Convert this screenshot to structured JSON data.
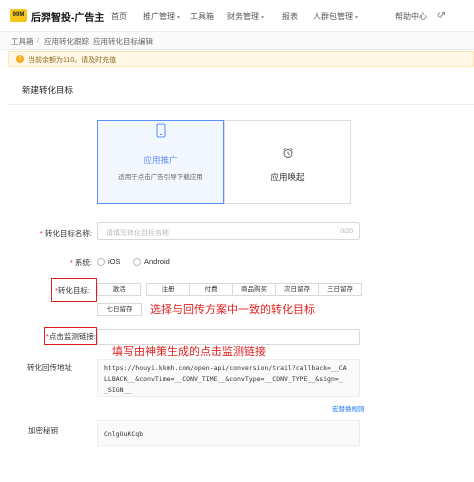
{
  "header": {
    "logo_badge": "99M",
    "app_title": "后羿智投-广告主",
    "nav": [
      {
        "label": "首页"
      },
      {
        "label": "推广管理"
      },
      {
        "label": "工具箱"
      },
      {
        "label": "财务管理"
      },
      {
        "label": "报表"
      },
      {
        "label": "人群包管理"
      },
      {
        "label": "帮助中心"
      }
    ]
  },
  "breadcrumb": [
    "工具箱",
    "应用转化跟踪",
    "应用转化目标编辑"
  ],
  "breadcrumb_sep": "/",
  "notice": {
    "text": "当前余额为110。请及时充值",
    "icon": "!"
  },
  "page": {
    "title": "新建转化目标"
  },
  "type_cards": [
    {
      "title": "应用推广",
      "desc": "适用于点击广告引导下载应用",
      "selected": true,
      "icon": "phone-icon"
    },
    {
      "title": "应用唤起",
      "desc": "",
      "selected": false,
      "icon": "alarm-clock-icon"
    }
  ],
  "form": {
    "name_label": "转化目标名称:",
    "name_placeholder": "请填写转化目标名称",
    "name_counter": "0/20",
    "system_label": "系统:",
    "system_options": [
      "iOS",
      "Android"
    ],
    "goal_label": "转化目标:",
    "goals": [
      "激活",
      "注册",
      "付费",
      "商品购买",
      "次日留存",
      "三日留存",
      "七日留存"
    ],
    "monitor_label": "点击监测链接:",
    "callback_label": "转化回传地址",
    "callback_lines": [
      "https://houyi.kkmh.com/open-api/conversion/trail?callback=__CA",
      "LLBACK__&convTime=__CONV_TIME__&convType=__CONV_TYPE__&sign=_",
      "_SIGN__"
    ],
    "callback_rule_link": "宏替换规则",
    "secret_label": "加密秘钥",
    "secret_value": "CnlgUuKCqb"
  },
  "annotations": {
    "goal_hint": "选择与回传方案中一致的转化目标",
    "monitor_hint": "填写由神策生成的点击监测链接"
  },
  "colors": {
    "accent": "#5b8ff9",
    "annotation": "#e02020",
    "notice_bg": "#fff8e6"
  }
}
